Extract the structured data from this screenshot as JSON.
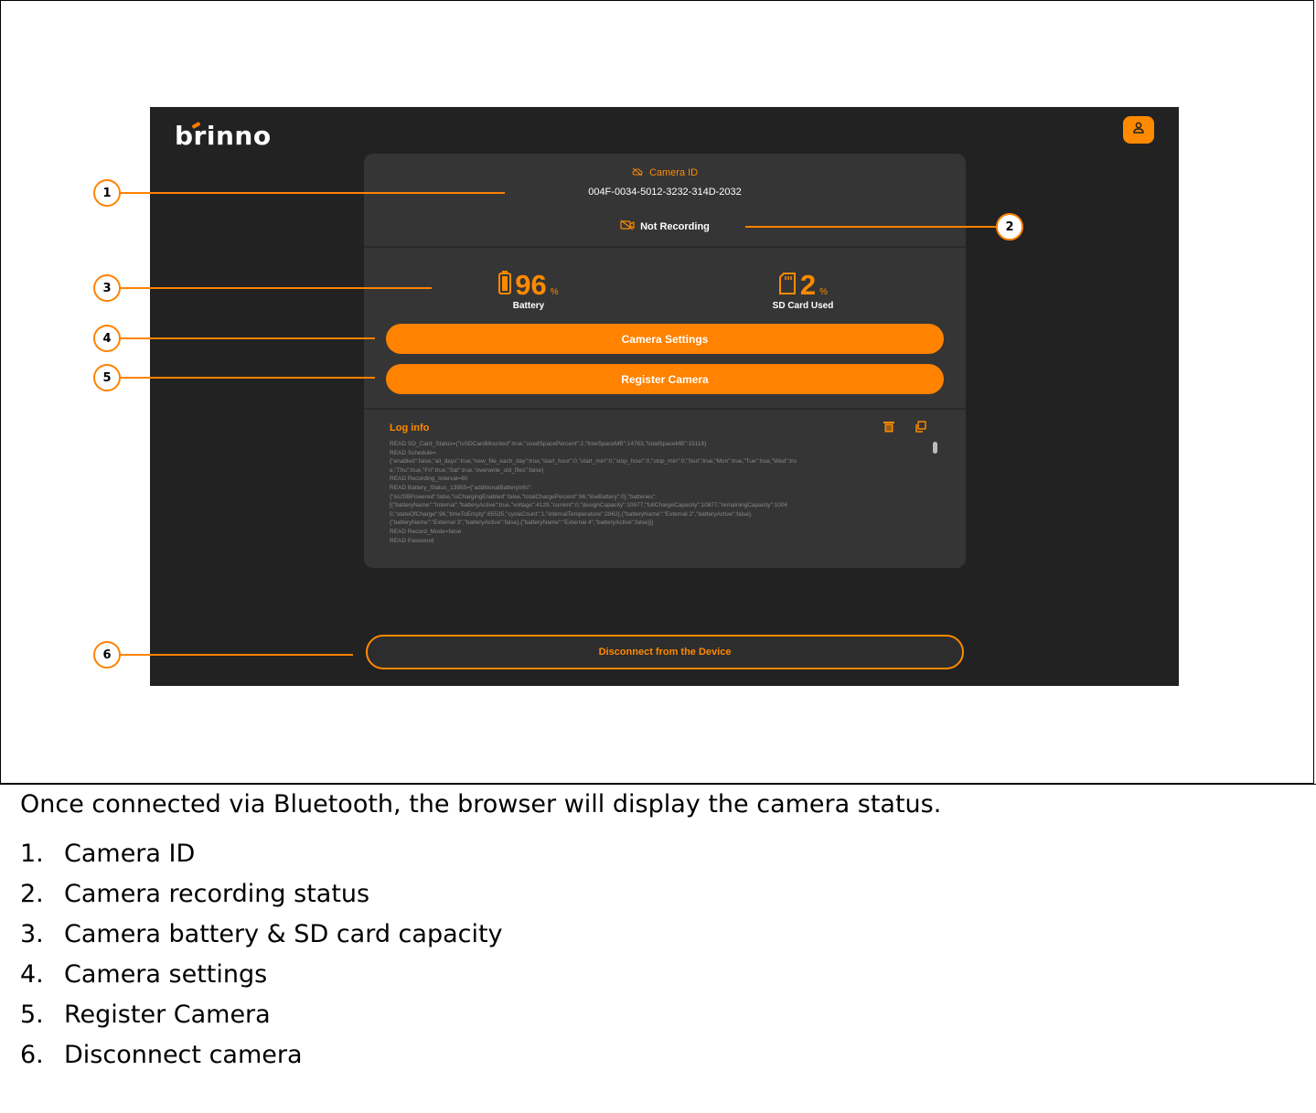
{
  "app": {
    "logo_text": "brinno"
  },
  "camera": {
    "id_label": "Camera ID",
    "id_value": "004F-0034-5012-3232-314D-2032",
    "recording_status": "Not Recording"
  },
  "stats": {
    "battery_value": "96",
    "battery_unit": "%",
    "battery_label": "Battery",
    "sd_value": "2",
    "sd_unit": "%",
    "sd_label": "SD Card Used"
  },
  "buttons": {
    "camera_settings": "Camera Settings",
    "register_camera": "Register Camera",
    "disconnect": "Disconnect from the Device"
  },
  "log": {
    "title": "Log info",
    "lines": [
      "READ SD_Card_Status={\"isSDCardMounted\":true,\"usedSpacePercent\":2,\"freeSpaceMB\":14763,\"totalSpaceMB\":15118}",
      "READ Schedule=",
      "{\"enabled\":false,\"all_days\":true,\"new_file_each_day\":true,\"start_hour\":0,\"start_min\":0,\"stop_hour\":0,\"stop_min\":0,\"Sun\":true,\"Mon\":true,\"Tue\":true,\"Wed\":tru",
      "e,\"Thu\":true,\"Fri\":true,\"Sat\":true,\"overwrite_old_files\":false}",
      "READ Recording_Interval=60",
      "READ Battery_Status_13955={\"additionalBatteryInfo\":",
      "{\"isUSBPowered\":false,\"isChargingEnabled\":false,\"totalChargePercent\":96,\"lowBattery\":0},\"batteries\":",
      "[{\"batteryName\":\"Internal\",\"batteryActive\":true,\"voltage\":4129,\"current\":0,\"designCapacity\":10877,\"fullChargeCapacity\":10877,\"remainingCapacity\":1006",
      "0,\"stateOfCharge\":96,\"timeToEmpty\":65535,\"cycleCount\":1,\"internalTemperature\":2962},{\"batteryName\":\"External 2\",\"batteryActive\":false},",
      "{\"batteryName\":\"External 3\",\"batteryActive\":false},{\"batteryName\":\"External 4\",\"batteryActive\":false}]}",
      "READ Record_Mode=false",
      "READ Password"
    ]
  },
  "callouts": [
    "1",
    "2",
    "3",
    "4",
    "5",
    "6"
  ],
  "doc": {
    "caption": "Once connected via Bluetooth, the browser will display the camera status.",
    "items": [
      {
        "num": "1.",
        "text": "Camera ID"
      },
      {
        "num": "2.",
        "text": "Camera recording status"
      },
      {
        "num": "3.",
        "text": "Camera battery & SD card capacity"
      },
      {
        "num": "4.",
        "text": "Camera settings"
      },
      {
        "num": "5.",
        "text": "Register Camera"
      },
      {
        "num": "6.",
        "text": "Disconnect camera"
      }
    ]
  },
  "colors": {
    "accent": "#ff8200",
    "background": "#222222",
    "panel": "#353535"
  }
}
